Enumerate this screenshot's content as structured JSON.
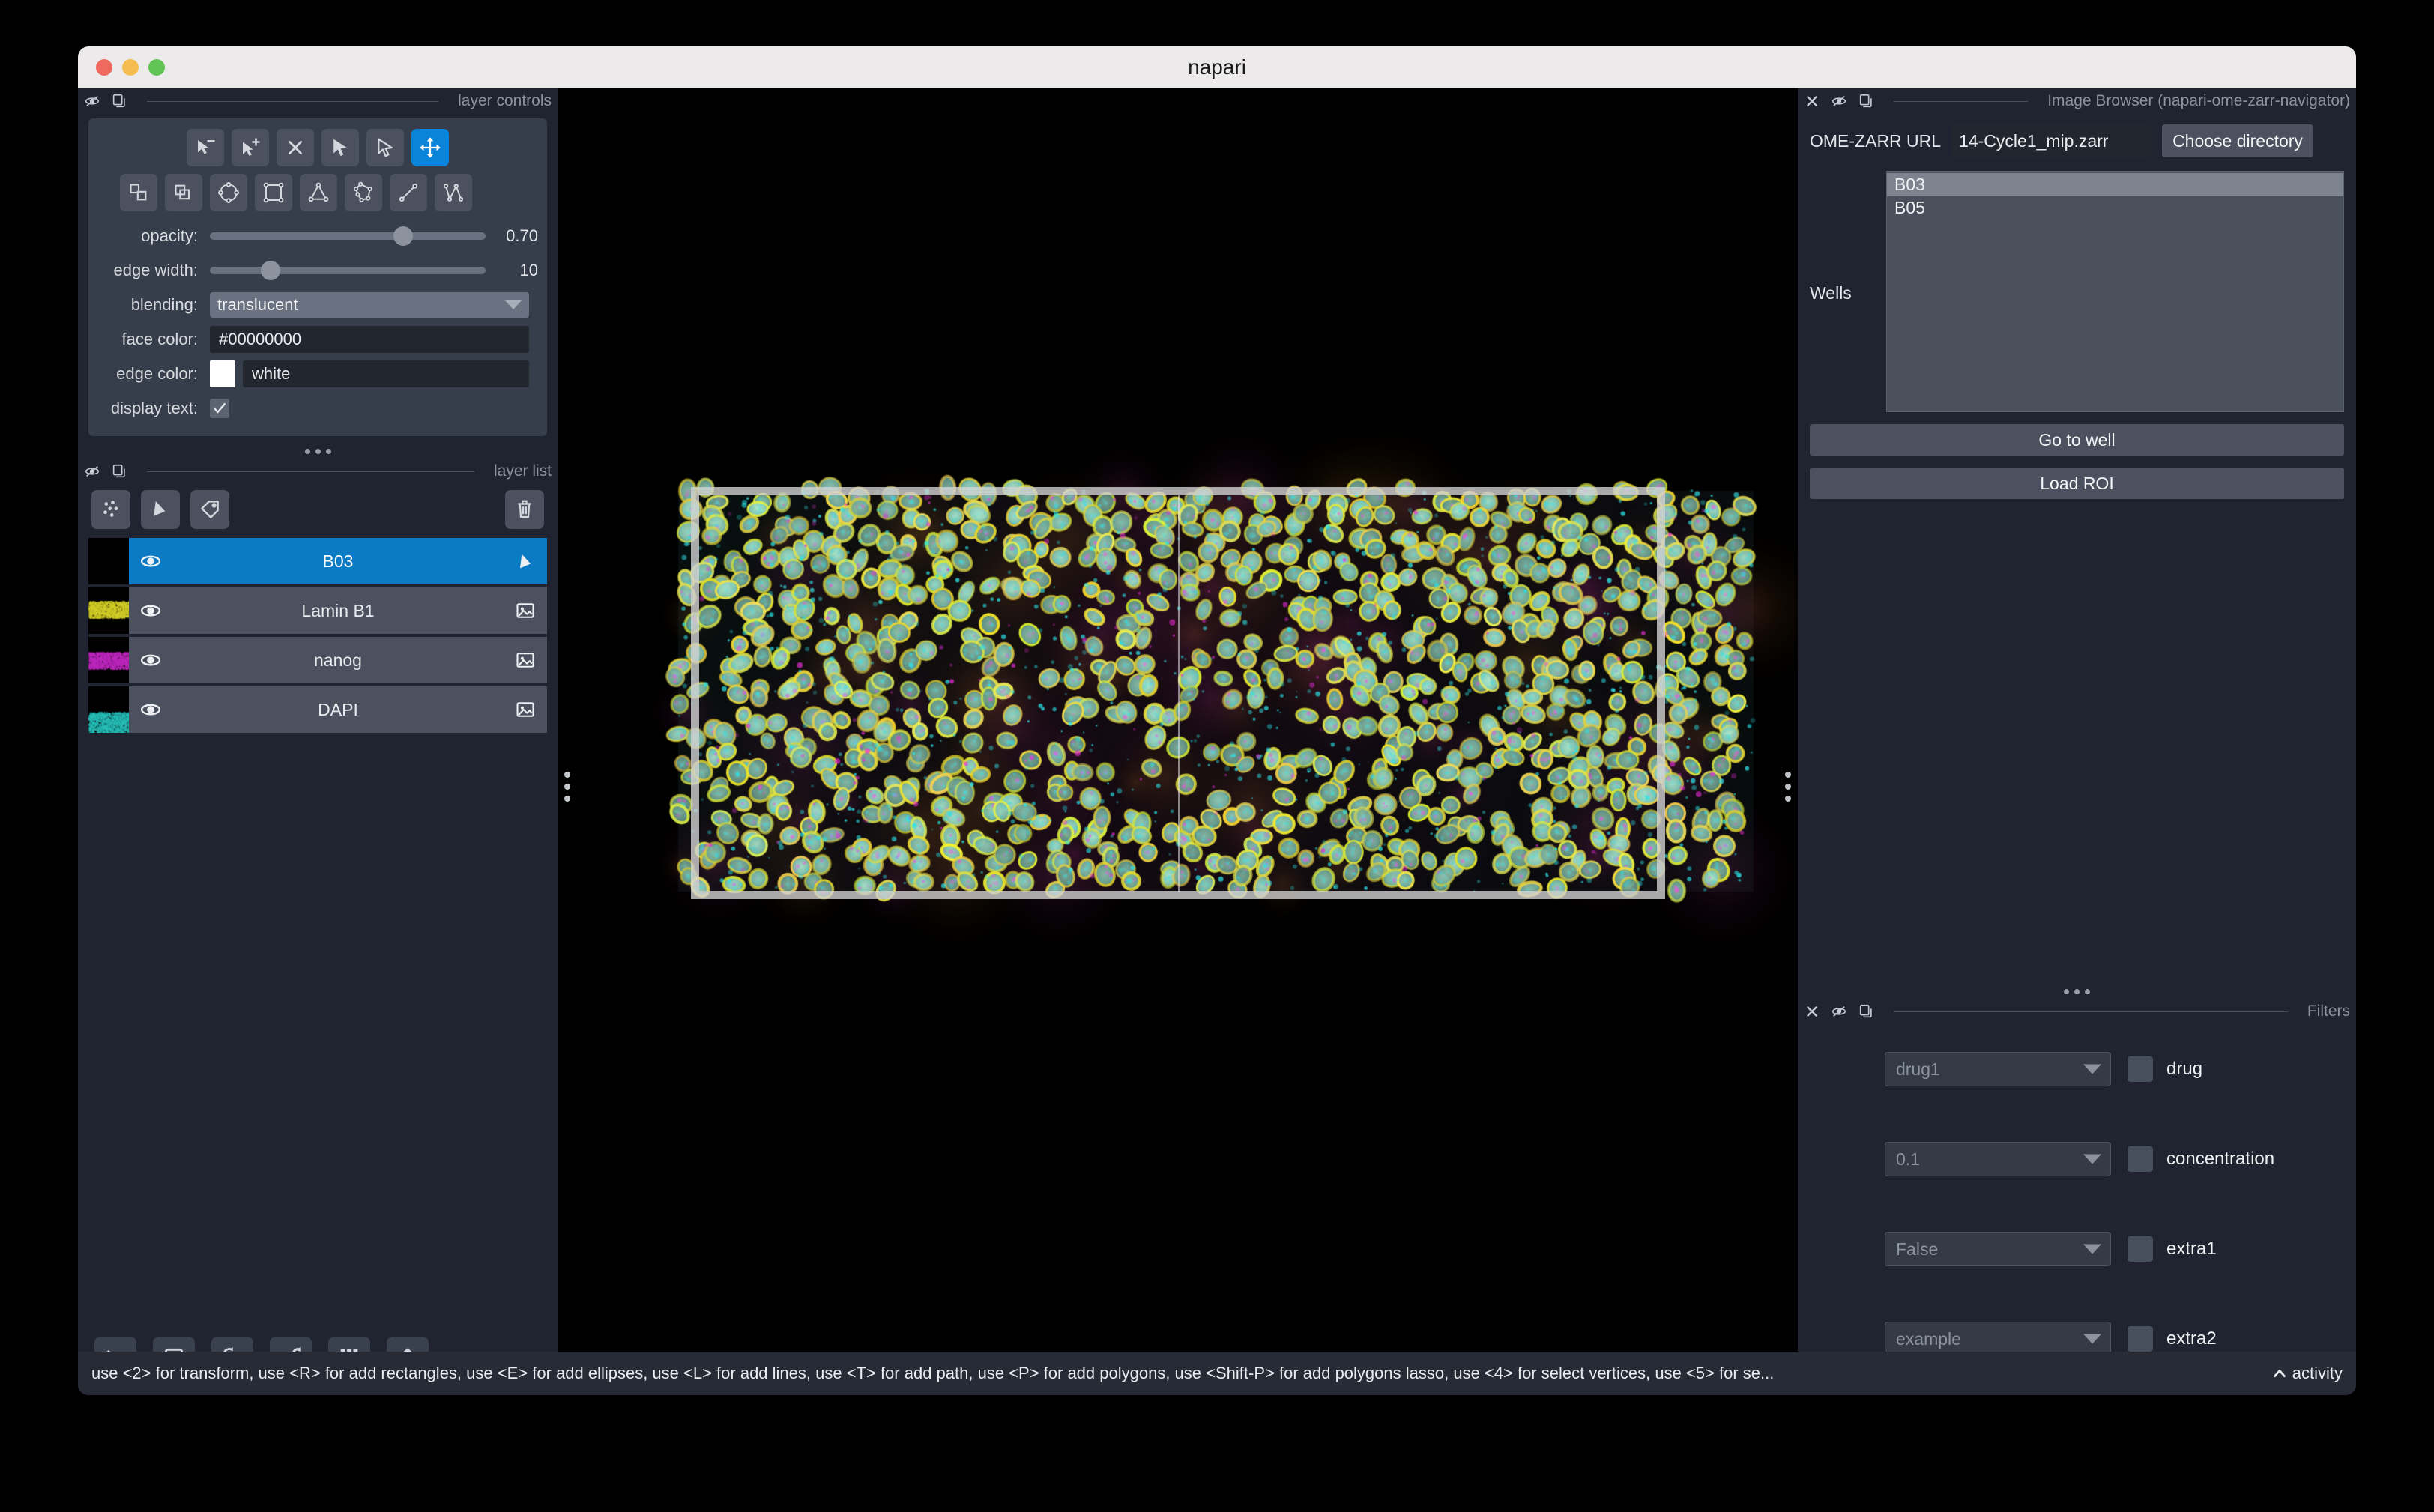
{
  "window": {
    "title": "napari",
    "traffic_lights": [
      "close-red",
      "minimize-yellow",
      "zoom-green"
    ]
  },
  "layer_controls": {
    "header": "layer controls",
    "header_icons": [
      "visibility-off-icon",
      "copy-icon"
    ],
    "mode_tools": [
      {
        "name": "select-delete-vertex-tool",
        "selected": false
      },
      {
        "name": "select-add-vertex-tool",
        "selected": false
      },
      {
        "name": "delete-shape-tool",
        "selected": false
      },
      {
        "name": "select-shapes-tool",
        "selected": false
      },
      {
        "name": "direct-select-tool",
        "selected": false
      },
      {
        "name": "pan-zoom-tool",
        "selected": true
      }
    ],
    "shape_tools": [
      {
        "name": "move-to-front-tool",
        "selected": false
      },
      {
        "name": "move-to-back-tool",
        "selected": false
      },
      {
        "name": "add-ellipse-tool",
        "selected": false
      },
      {
        "name": "add-rectangle-tool",
        "selected": false
      },
      {
        "name": "add-triangle-tool",
        "selected": false
      },
      {
        "name": "add-polygon-tool",
        "selected": false
      },
      {
        "name": "add-line-tool",
        "selected": false
      },
      {
        "name": "add-path-tool",
        "selected": false
      }
    ],
    "opacity": {
      "label": "opacity:",
      "value": "0.70",
      "percent": 70
    },
    "edge_width": {
      "label": "edge width:",
      "value": "10",
      "percent": 22
    },
    "blending": {
      "label": "blending:",
      "value": "translucent"
    },
    "face_color": {
      "label": "face color:",
      "value": "#00000000"
    },
    "edge_color": {
      "label": "edge color:",
      "value": "white",
      "swatch": "#ffffff"
    },
    "display_text": {
      "label": "display text:",
      "checked": true
    }
  },
  "layer_list": {
    "header": "layer list",
    "header_icons": [
      "visibility-off-icon",
      "copy-icon"
    ],
    "tools": [
      {
        "name": "new-points-layer-button"
      },
      {
        "name": "new-shapes-layer-button"
      },
      {
        "name": "new-labels-layer-button"
      },
      {
        "name": "delete-layer-button"
      }
    ],
    "layers": [
      {
        "name": "B03",
        "type": "shapes",
        "visible": true,
        "selected": true,
        "thumb": "black"
      },
      {
        "name": "Lamin B1",
        "type": "image",
        "visible": true,
        "selected": false,
        "thumb": "yellow"
      },
      {
        "name": "nanog",
        "type": "image",
        "visible": true,
        "selected": false,
        "thumb": "magenta"
      },
      {
        "name": "DAPI",
        "type": "image",
        "visible": true,
        "selected": false,
        "thumb": "cyan"
      }
    ]
  },
  "viewer_buttons": [
    {
      "name": "console-button",
      "icon": "terminal-icon"
    },
    {
      "name": "ndisplay-toggle-button",
      "icon": "square-icon"
    },
    {
      "name": "roll-dims-button",
      "icon": "cube-rotate-icon"
    },
    {
      "name": "transpose-dims-button",
      "icon": "square-rotate-icon"
    },
    {
      "name": "grid-view-button",
      "icon": "grid-icon"
    },
    {
      "name": "home-button",
      "icon": "home-icon"
    }
  ],
  "image_browser": {
    "header": "Image Browser (napari-ome-zarr-navigator)",
    "header_icons": [
      "close-icon",
      "visibility-off-icon",
      "copy-icon"
    ],
    "url_label": "OME-ZARR URL",
    "url_value": "14-Cycle1_mip.zarr",
    "choose_directory_label": "Choose directory",
    "wells_label": "Wells",
    "wells": [
      {
        "label": "B03",
        "selected": true
      },
      {
        "label": "B05",
        "selected": false
      }
    ],
    "go_to_well_label": "Go to well",
    "load_roi_label": "Load ROI"
  },
  "filters": {
    "header": "Filters",
    "header_icons": [
      "close-icon",
      "visibility-off-icon",
      "copy-icon"
    ],
    "rows": [
      {
        "value": "drug1",
        "label": "drug",
        "checked": false
      },
      {
        "value": "0.1",
        "label": "concentration",
        "checked": false
      },
      {
        "value": "False",
        "label": "extra1",
        "checked": false
      },
      {
        "value": "example",
        "label": "extra2",
        "checked": false
      }
    ]
  },
  "status_bar": {
    "text": "use <2> for transform, use <R> for add rectangles, use <E> for add ellipses, use <L> for add lines, use <T> for add path, use <P> for add polygons, use <Shift-P> for add polygons lasso, use <4> for select vertices, use <5> for se...",
    "activity_label": "activity",
    "activity_icon": "chevron-up-icon"
  },
  "canvas": {
    "name": "image-canvas",
    "roi_rectangle": {
      "name": "roi-shape-overlay",
      "stroke": "#d0d0d0"
    },
    "background": "#000000"
  }
}
